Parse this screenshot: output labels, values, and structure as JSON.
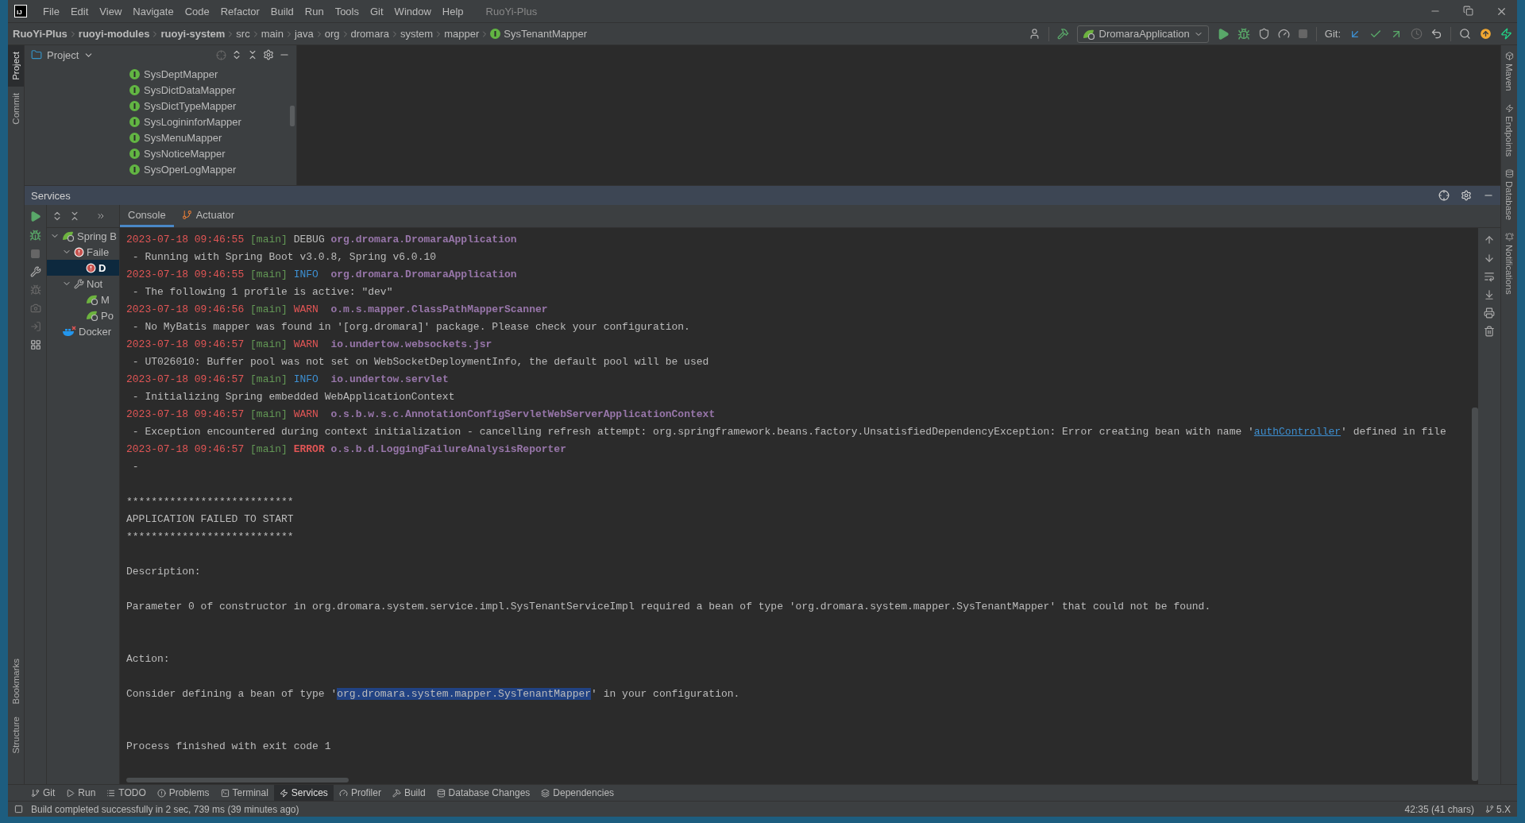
{
  "window": {
    "title": "RuoYi-Plus",
    "logo": "IJ"
  },
  "menu": [
    "File",
    "Edit",
    "View",
    "Navigate",
    "Code",
    "Refactor",
    "Build",
    "Run",
    "Tools",
    "Git",
    "Window",
    "Help"
  ],
  "breadcrumb": [
    {
      "label": "RuoYi-Plus",
      "kind": "module"
    },
    {
      "label": "ruoyi-modules",
      "kind": "module"
    },
    {
      "label": "ruoyi-system",
      "kind": "module"
    },
    {
      "label": "src",
      "kind": "folder"
    },
    {
      "label": "main",
      "kind": "folder"
    },
    {
      "label": "java",
      "kind": "folder"
    },
    {
      "label": "org",
      "kind": "folder"
    },
    {
      "label": "dromara",
      "kind": "folder"
    },
    {
      "label": "system",
      "kind": "folder"
    },
    {
      "label": "mapper",
      "kind": "folder"
    },
    {
      "label": "SysTenantMapper",
      "kind": "interface"
    }
  ],
  "toolbar": {
    "run_config": "DromaraApplication",
    "git_label": "Git:"
  },
  "left_stripe": {
    "top": [
      {
        "label": "Project",
        "selected": true
      },
      {
        "label": "Commit",
        "selected": false
      }
    ],
    "bottom": [
      {
        "label": "Bookmarks",
        "selected": false
      },
      {
        "label": "Structure",
        "selected": false
      }
    ]
  },
  "right_stripe": [
    "Maven",
    "Endpoints",
    "Database",
    "Notifications"
  ],
  "project": {
    "title": "Project",
    "items": [
      "SysDeptMapper",
      "SysDictDataMapper",
      "SysDictTypeMapper",
      "SysLogininforMapper",
      "SysMenuMapper",
      "SysNoticeMapper",
      "SysOperLogMapper"
    ]
  },
  "services": {
    "title": "Services",
    "tree": [
      {
        "label": "Spring B",
        "kind": "spring",
        "expanded": true,
        "selected": false,
        "children": [
          {
            "label": "Faile",
            "kind": "error",
            "expanded": true,
            "selected": false,
            "children": [
              {
                "label": "D",
                "kind": "error",
                "selected": true
              }
            ]
          },
          {
            "label": "Not",
            "kind": "wrench",
            "expanded": true,
            "selected": false,
            "children": [
              {
                "label": "M",
                "kind": "spring",
                "selected": false
              },
              {
                "label": "Po",
                "kind": "spring",
                "selected": false
              }
            ]
          }
        ]
      },
      {
        "label": "Docker",
        "kind": "docker",
        "selected": false
      }
    ],
    "tabs": [
      {
        "label": "Console",
        "selected": true
      },
      {
        "label": "Actuator",
        "selected": false
      }
    ],
    "console": [
      {
        "kind": "debug",
        "date": "2023-07-18 09:46:55",
        "thread": "[main]",
        "level": "DEBUG",
        "logger": "org.dromara.DromaraApplication"
      },
      {
        "kind": "text",
        "parts": [
          {
            "text": " - Running with Spring Boot v3.0.8, Spring v6.0.10",
            "kind": "plain"
          }
        ]
      },
      {
        "kind": "info",
        "date": "2023-07-18 09:46:55",
        "thread": "[main]",
        "level": "INFO",
        "logger": "org.dromara.DromaraApplication"
      },
      {
        "kind": "text",
        "parts": [
          {
            "text": " - The following 1 profile is active: \"dev\"",
            "kind": "plain"
          }
        ]
      },
      {
        "kind": "warn",
        "date": "2023-07-18 09:46:56",
        "thread": "[main]",
        "level": "WARN",
        "logger": "o.m.s.mapper.ClassPathMapperScanner"
      },
      {
        "kind": "text",
        "parts": [
          {
            "text": " - No MyBatis mapper was found in '[org.dromara]' package. Please check your configuration.",
            "kind": "plain"
          }
        ]
      },
      {
        "kind": "warn",
        "date": "2023-07-18 09:46:57",
        "thread": "[main]",
        "level": "WARN",
        "logger": "io.undertow.websockets.jsr"
      },
      {
        "kind": "text",
        "parts": [
          {
            "text": " - UT026010: Buffer pool was not set on WebSocketDeploymentInfo, the default pool will be used",
            "kind": "plain"
          }
        ]
      },
      {
        "kind": "info",
        "date": "2023-07-18 09:46:57",
        "thread": "[main]",
        "level": "INFO",
        "logger": "io.undertow.servlet"
      },
      {
        "kind": "text",
        "parts": [
          {
            "text": " - Initializing Spring embedded WebApplicationContext",
            "kind": "plain"
          }
        ]
      },
      {
        "kind": "warn",
        "date": "2023-07-18 09:46:57",
        "thread": "[main]",
        "level": "WARN",
        "logger": "o.s.b.w.s.c.AnnotationConfigServletWebServerApplicationContext"
      },
      {
        "kind": "text",
        "parts": [
          {
            "text": " - Exception encountered during context initialization - cancelling refresh attempt: org.springframework.beans.factory.UnsatisfiedDependencyException: Error creating bean with name '",
            "kind": "plain"
          },
          {
            "text": "authController",
            "kind": "link"
          },
          {
            "text": "' defined in file",
            "kind": "plain"
          }
        ]
      },
      {
        "kind": "error",
        "date": "2023-07-18 09:46:57",
        "thread": "[main]",
        "level": "ERROR",
        "logger": "o.s.b.d.LoggingFailureAnalysisReporter"
      },
      {
        "kind": "text",
        "parts": [
          {
            "text": " -",
            "kind": "plain"
          }
        ]
      },
      {
        "kind": "blank"
      },
      {
        "kind": "text",
        "parts": [
          {
            "text": "***************************",
            "kind": "plain"
          }
        ]
      },
      {
        "kind": "text",
        "parts": [
          {
            "text": "APPLICATION FAILED TO START",
            "kind": "plain"
          }
        ]
      },
      {
        "kind": "text",
        "parts": [
          {
            "text": "***************************",
            "kind": "plain"
          }
        ]
      },
      {
        "kind": "blank"
      },
      {
        "kind": "text",
        "parts": [
          {
            "text": "Description:",
            "kind": "plain"
          }
        ]
      },
      {
        "kind": "blank"
      },
      {
        "kind": "text",
        "parts": [
          {
            "text": "Parameter 0 of constructor in org.dromara.system.service.impl.SysTenantServiceImpl required a bean of type 'org.dromara.system.mapper.SysTenantMapper' that could not be found.",
            "kind": "plain"
          }
        ]
      },
      {
        "kind": "blank"
      },
      {
        "kind": "blank"
      },
      {
        "kind": "text",
        "parts": [
          {
            "text": "Action:",
            "kind": "plain"
          }
        ]
      },
      {
        "kind": "blank"
      },
      {
        "kind": "text",
        "parts": [
          {
            "text": "Consider defining a bean of type '",
            "kind": "plain"
          },
          {
            "text": "org.dromara.system.mapper.SysTenantMapper",
            "kind": "selected"
          },
          {
            "text": "' in your configuration.",
            "kind": "plain"
          }
        ]
      },
      {
        "kind": "blank"
      },
      {
        "kind": "blank"
      },
      {
        "kind": "text",
        "parts": [
          {
            "text": "Process finished with exit code 1",
            "kind": "plain"
          }
        ]
      }
    ]
  },
  "bottom_tools": [
    {
      "label": "Git",
      "kind": "git",
      "selected": false
    },
    {
      "label": "Run",
      "kind": "run",
      "selected": false
    },
    {
      "label": "TODO",
      "kind": "todo",
      "selected": false
    },
    {
      "label": "Problems",
      "kind": "problems",
      "selected": false
    },
    {
      "label": "Terminal",
      "kind": "terminal",
      "selected": false
    },
    {
      "label": "Services",
      "kind": "services",
      "selected": true
    },
    {
      "label": "Profiler",
      "kind": "profiler",
      "selected": false
    },
    {
      "label": "Build",
      "kind": "build",
      "selected": false
    },
    {
      "label": "Database Changes",
      "kind": "database",
      "selected": false
    },
    {
      "label": "Dependencies",
      "kind": "deps",
      "selected": false
    }
  ],
  "status": {
    "message": "Build completed successfully in 2 sec, 739 ms (39 minutes ago)",
    "position": "42:35 (41 chars)",
    "branch": "5.X"
  }
}
